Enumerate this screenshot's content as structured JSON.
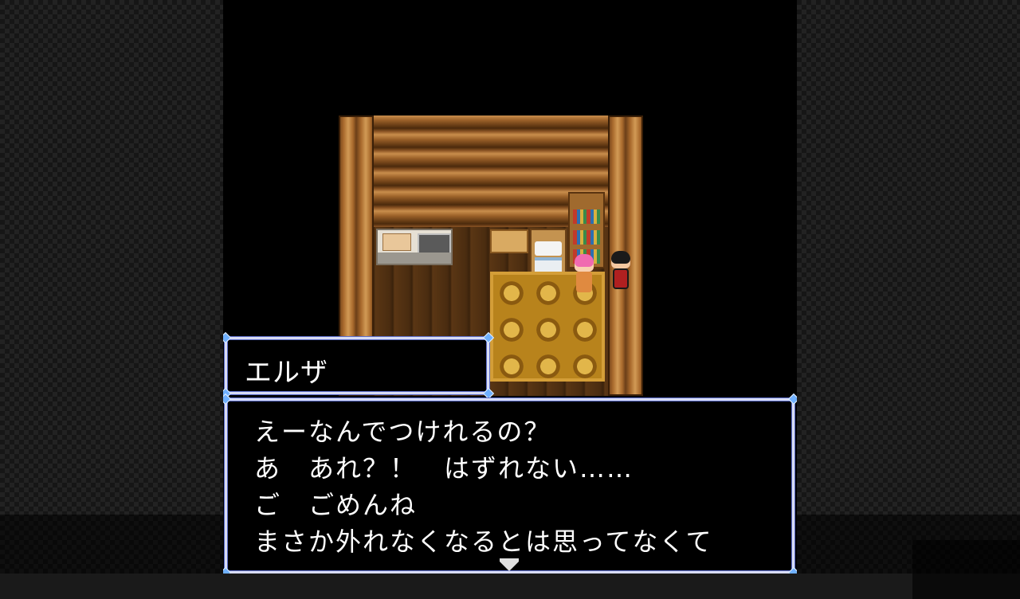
{
  "dialogue": {
    "speaker": "エルザ",
    "lines": [
      "えーなんでつけれるの？",
      "あ　あれ？！　はずれない……",
      "ご　ごめんね",
      "まさか外れなくなるとは思ってなくて"
    ]
  },
  "colors": {
    "window_border": "#d8dcf4",
    "window_accent": "#5b6cc8",
    "corner_gem": "#6fb0ff",
    "text": "#ffffff"
  },
  "icons": {
    "advance_indicator": "down-triangle"
  }
}
